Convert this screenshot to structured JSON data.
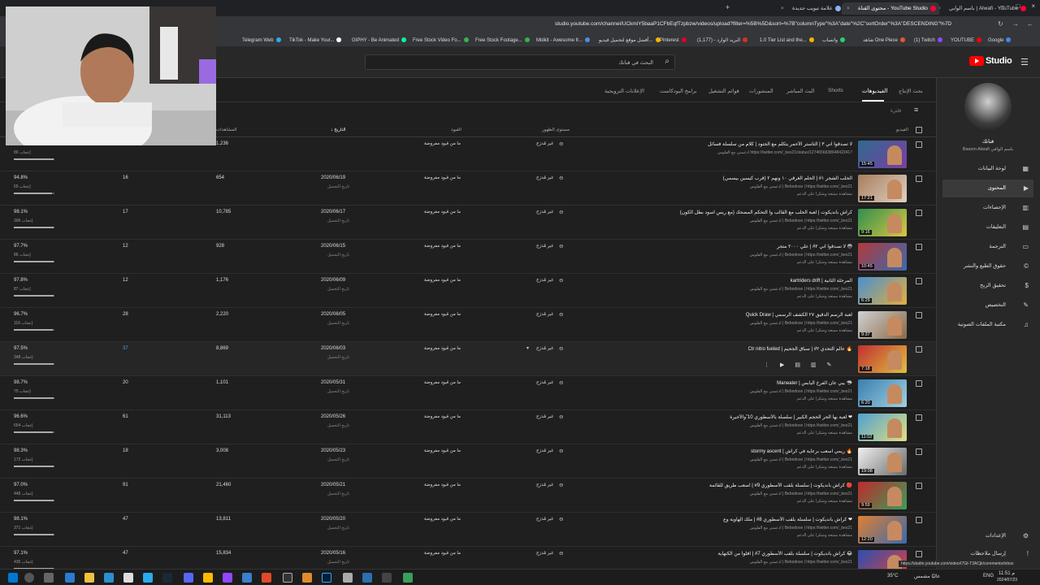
{
  "browser": {
    "tabs": [
      {
        "label": "باسم الوابي | Alwafi - YouTube"
      },
      {
        "label": "محتوى القناة - YouTube Studio"
      },
      {
        "label": "علامة تبويب جديدة"
      }
    ],
    "url": "studio.youtube.com/channel/UCkmiY5baaP1CFbEqfTzpbzw/videos/upload?filter=%5B%5D&sort=%7B\"columnType\"%3A\"date\"%2C\"sortOrder\"%3A\"DESCENDING\"%7D",
    "bookmarks": [
      {
        "label": "YOUTUBE",
        "color": "#ff0000"
      },
      {
        "label": "(1) Twitch",
        "color": "#9146ff"
      },
      {
        "label": "شاهد One Piece",
        "color": "#e05a2b"
      },
      {
        "label": "واتساب",
        "color": "#25d366"
      },
      {
        "label": "البريد الوارد - (1,177)",
        "color": "#d93025"
      },
      {
        "label": "Pinterest",
        "color": "#e60023"
      },
      {
        "label": "أفضل موقع لتحميل فيديو...",
        "color": "#f4b400"
      },
      {
        "label": "Midkit - Awesome fr...",
        "color": "#4a90e2"
      },
      {
        "label": "Free Stock Footage...",
        "color": "#37b24d"
      },
      {
        "label": "Free Stock Video Fo...",
        "color": "#37b24d"
      },
      {
        "label": "GIPHY - Be Animated",
        "color": "#00ff99"
      },
      {
        "label": "TikTok - Make Your...",
        "color": "#ffffff"
      },
      {
        "label": "Telegram Web",
        "color": "#2aabee"
      },
      {
        "label": "Google",
        "color": "#4285f4"
      },
      {
        "label": "1.0 Tier List and the...",
        "color": "#f4b400"
      }
    ]
  },
  "header": {
    "search_placeholder": "البحث في قناتك",
    "logo_text": "Studio"
  },
  "sidebar": {
    "channel_name": "قناتك",
    "channel_sub": "Basem Alwafi باسم الوافي",
    "items": [
      {
        "label": "لوحة البيانات",
        "icon": "dashboard-icon"
      },
      {
        "label": "المحتوى",
        "icon": "content-icon",
        "active": true
      },
      {
        "label": "الإحصاءات",
        "icon": "analytics-icon"
      },
      {
        "label": "التعليقات",
        "icon": "comments-icon"
      },
      {
        "label": "الترجمة",
        "icon": "subtitles-icon"
      },
      {
        "label": "حقوق الطبع والنشر",
        "icon": "copyright-icon"
      },
      {
        "label": "تحقيق الربح",
        "icon": "monetization-icon"
      },
      {
        "label": "التخصيص",
        "icon": "customization-icon"
      },
      {
        "label": "مكتبة الملفات الصوتية",
        "icon": "audio-library-icon"
      }
    ],
    "settings_label": "الإعدادات",
    "feedback_label": "إرسال ملاحظات"
  },
  "content_tabs": [
    {
      "label": "بحث الإنتاج"
    },
    {
      "label": "الفيديوهات",
      "active": true
    },
    {
      "label": "Shorts"
    },
    {
      "label": "البث المباشر"
    },
    {
      "label": "المنشورات"
    },
    {
      "label": "قوائم التشغيل"
    },
    {
      "label": "برامج البودكاست"
    },
    {
      "label": "الإعلانات الترويجية"
    }
  ],
  "filter_label": "فلترة",
  "columns": {
    "video": "الفيديو",
    "visibility": "مستوى الظهور",
    "restrictions": "القيود",
    "date": "التاريخ",
    "views": "المشاهدات",
    "comments": "التعليقات",
    "likes": "الإعجابات (مقابل عدم الإعجاب)"
  },
  "videos": [
    {
      "title": "لا تصدقوا اني ٣ | التاستر الأحمر يتكلم مع الجنود | كلام من سلسلة فسائل",
      "desc": "ادعمني مع الفلوس https://twitter.com/_bes21/status/1274656638648422417",
      "desc2": "",
      "duration": "15:45",
      "date": "",
      "views": "1,236",
      "comments": "8",
      "likes_pct": "97.9%",
      "likes": "80 إعجاب",
      "fill": 0.979,
      "thumb": [
        "#2f6a8f",
        "#7a3fa3"
      ]
    },
    {
      "title": "الحلب الشجر ١# | الحلم الغرقي ١٠ ونهم ٢ (قرب كيسين بيسمي)",
      "desc": "ادعمني مع الفلوس | Bebodose | https://twitter.com/_bes21",
      "desc2": "مشاهدة ممتعة وشكراً على الدعم",
      "duration": "17:21",
      "date": "2020/06/19",
      "views": "654",
      "comments": "16",
      "likes_pct": "94.8%",
      "likes": "55 إعجاب",
      "fill": 0.948,
      "thumb": [
        "#a87f5e",
        "#e0d0c0"
      ]
    },
    {
      "title": "كراش بانديكوت | لعبة الحلب مع القالب وا التحكم المضحك (مع ريس اسود بطل الكون)",
      "desc": "ادعمني مع الفلوس | Bebodose | https://twitter.com/_bes21",
      "desc2": "مشاهدة ممتعة وشكراً على الدعم",
      "duration": "9:16",
      "date": "2020/06/17",
      "views": "10,785",
      "comments": "17",
      "likes_pct": "98.1%",
      "likes": "306 إعجاب",
      "fill": 0.981,
      "thumb": [
        "#2f8f4f",
        "#d9c740"
      ]
    },
    {
      "title": "لا تصدقوا اني ٢# | علي ٢٠٠٠ متجر 😳",
      "desc": "ادعمني مع الفلوس | Bebodose | https://twitter.com/_bes21",
      "desc2": "مشاهدة ممتعة وشكراً على الدعم",
      "duration": "10:45",
      "date": "2020/06/15",
      "views": "928",
      "comments": "12",
      "likes_pct": "97.7%",
      "likes": "86 إعجاب",
      "fill": 0.977,
      "thumb": [
        "#b03a3a",
        "#3a6ab0"
      ]
    },
    {
      "title": "kartriders drift | المرحلة الثانية",
      "desc": "ادعمني مع الفلوس | Bebodose | https://twitter.com/_bes21",
      "desc2": "مشاهدة ممتعة وشكراً على الدعم",
      "duration": "6:29",
      "date": "2020/06/09",
      "views": "1,176",
      "comments": "12",
      "likes_pct": "97.8%",
      "likes": "87 إعجاب",
      "fill": 0.978,
      "thumb": [
        "#4a8fd0",
        "#e0b040"
      ]
    },
    {
      "title": "Quick Draw | لعبة الرسم الدقيق ٢٧ الكشف الرسمي",
      "desc": "ادعمني مع الفلوس | Bebodose | https://twitter.com/_bes21",
      "desc2": "مشاهدة ممتعة وشكراً على الدعم",
      "duration": "9:37",
      "date": "2020/06/05",
      "views": "2,220",
      "comments": "28",
      "likes_pct": "96.7%",
      "likes": "116 إعجاب",
      "fill": 0.967,
      "thumb": [
        "#d0d0d0",
        "#8a6a4a"
      ]
    },
    {
      "title": "Ctr nitro fueled | عالم التحدي ٢# | سباق الجحيم 🔥",
      "desc": "",
      "desc2": "",
      "duration": "7:18",
      "date": "2020/06/03",
      "views": "8,869",
      "comments": "37",
      "likes_pct": "97.5%",
      "likes": "348 إعجاب",
      "fill": 0.975,
      "thumb": [
        "#c03030",
        "#e0c040"
      ],
      "hover": true
    },
    {
      "title": "Maneater | يبي عان الفرخ اليابس 🦈",
      "desc": "ادعمني مع الفلوس | Bebodose | https://twitter.com/_bes21",
      "desc2": "مشاهدة ممتعة وشكراً على الدعم",
      "duration": "6:20",
      "date": "2020/05/31",
      "views": "1,101",
      "comments": "20",
      "likes_pct": "98.7%",
      "likes": "75 إعجاب",
      "fill": 0.987,
      "thumb": [
        "#3a7fb0",
        "#a0d0e0"
      ]
    },
    {
      "title": "لعبة بها الحر الحجم الكبير | سلسلة بالأسطوري 10 ٌوالأخيرة ❤",
      "desc": "ادعمني مع الفلوس | Bebodose | https://twitter.com/_bes21",
      "desc2": "مشاهدة ممتعة وشكراً على الدعم",
      "duration": "11:02",
      "date": "2020/05/26",
      "views": "31,113",
      "comments": "61",
      "likes_pct": "96.6%",
      "likes": "654 إعجاب",
      "fill": 0.966,
      "thumb": [
        "#50a0d0",
        "#e0e080"
      ]
    },
    {
      "title": "stormy ascent | ريمي اسعب برعاية في كراش 🔥",
      "desc": "ادعمني مع الفلوس | Bebodose | https://twitter.com/_bes21",
      "desc2": "مشاهدة ممتعة وشكراً على الدعم",
      "duration": "19:08",
      "date": "2020/05/23",
      "views": "3,008",
      "comments": "18",
      "likes_pct": "98.3%",
      "likes": "172 إعجاب",
      "fill": 0.983,
      "thumb": [
        "#f0f0f0",
        "#6a6a6a"
      ]
    },
    {
      "title": "كراش بانديكوت | سلسلة بلقب الأسطوري 9# | اصعب طريق للقائمة 🔴",
      "desc": "ادعمني مع الفلوس | Bebodose | https://twitter.com/_bes21",
      "desc2": "مشاهدة ممتعة وشكراً على الدعم",
      "duration": "9:59",
      "date": "2020/05/21",
      "views": "21,460",
      "comments": "91",
      "likes_pct": "97.0%",
      "likes": "448 إعجاب",
      "fill": 0.97,
      "thumb": [
        "#c02a2a",
        "#3a9f5a"
      ]
    },
    {
      "title": "كراش بانديكوت | سلسلة بلقب الأسطوري 8# | ملك الهاوية وع ❤",
      "desc": "ادعمني مع الفلوس | Bebodose | https://twitter.com/_bes21",
      "desc2": "مشاهدة ممتعة وشكراً على الدعم",
      "duration": "12:20",
      "date": "2020/05/20",
      "views": "13,811",
      "comments": "47",
      "likes_pct": "98.1%",
      "likes": "371 إعجاب",
      "fill": 0.981,
      "thumb": [
        "#e08030",
        "#3a6ab0"
      ]
    },
    {
      "title": "كراش بانديكوت | سلسلة بلقب الأسطوري 7# | افلوا من الكنهاية 😂",
      "desc": "ادعمني مع الفلوس | Bebodose | https://twitter.com/_bes21",
      "desc2": "",
      "duration": "",
      "date": "2020/05/16",
      "views": "15,834",
      "comments": "47",
      "likes_pct": "97.1%",
      "likes": "435 إعجاب",
      "fill": 0.971,
      "thumb": [
        "#2a4fb0",
        "#e04040"
      ]
    }
  ],
  "row_common": {
    "visibility": "غير مُدرَج",
    "restrictions": "ما من قيود مفروضة",
    "date_sub": "تاريخ التحميل"
  },
  "status_url": "https://studio.youtube.com/video/I7Gt-T3ACjk/comments/inbox",
  "tray": {
    "temp": "35°C",
    "weather": "غالبًا مشمس",
    "lang": "ENG",
    "time": "11:51 م",
    "date": "2024/07/23"
  }
}
